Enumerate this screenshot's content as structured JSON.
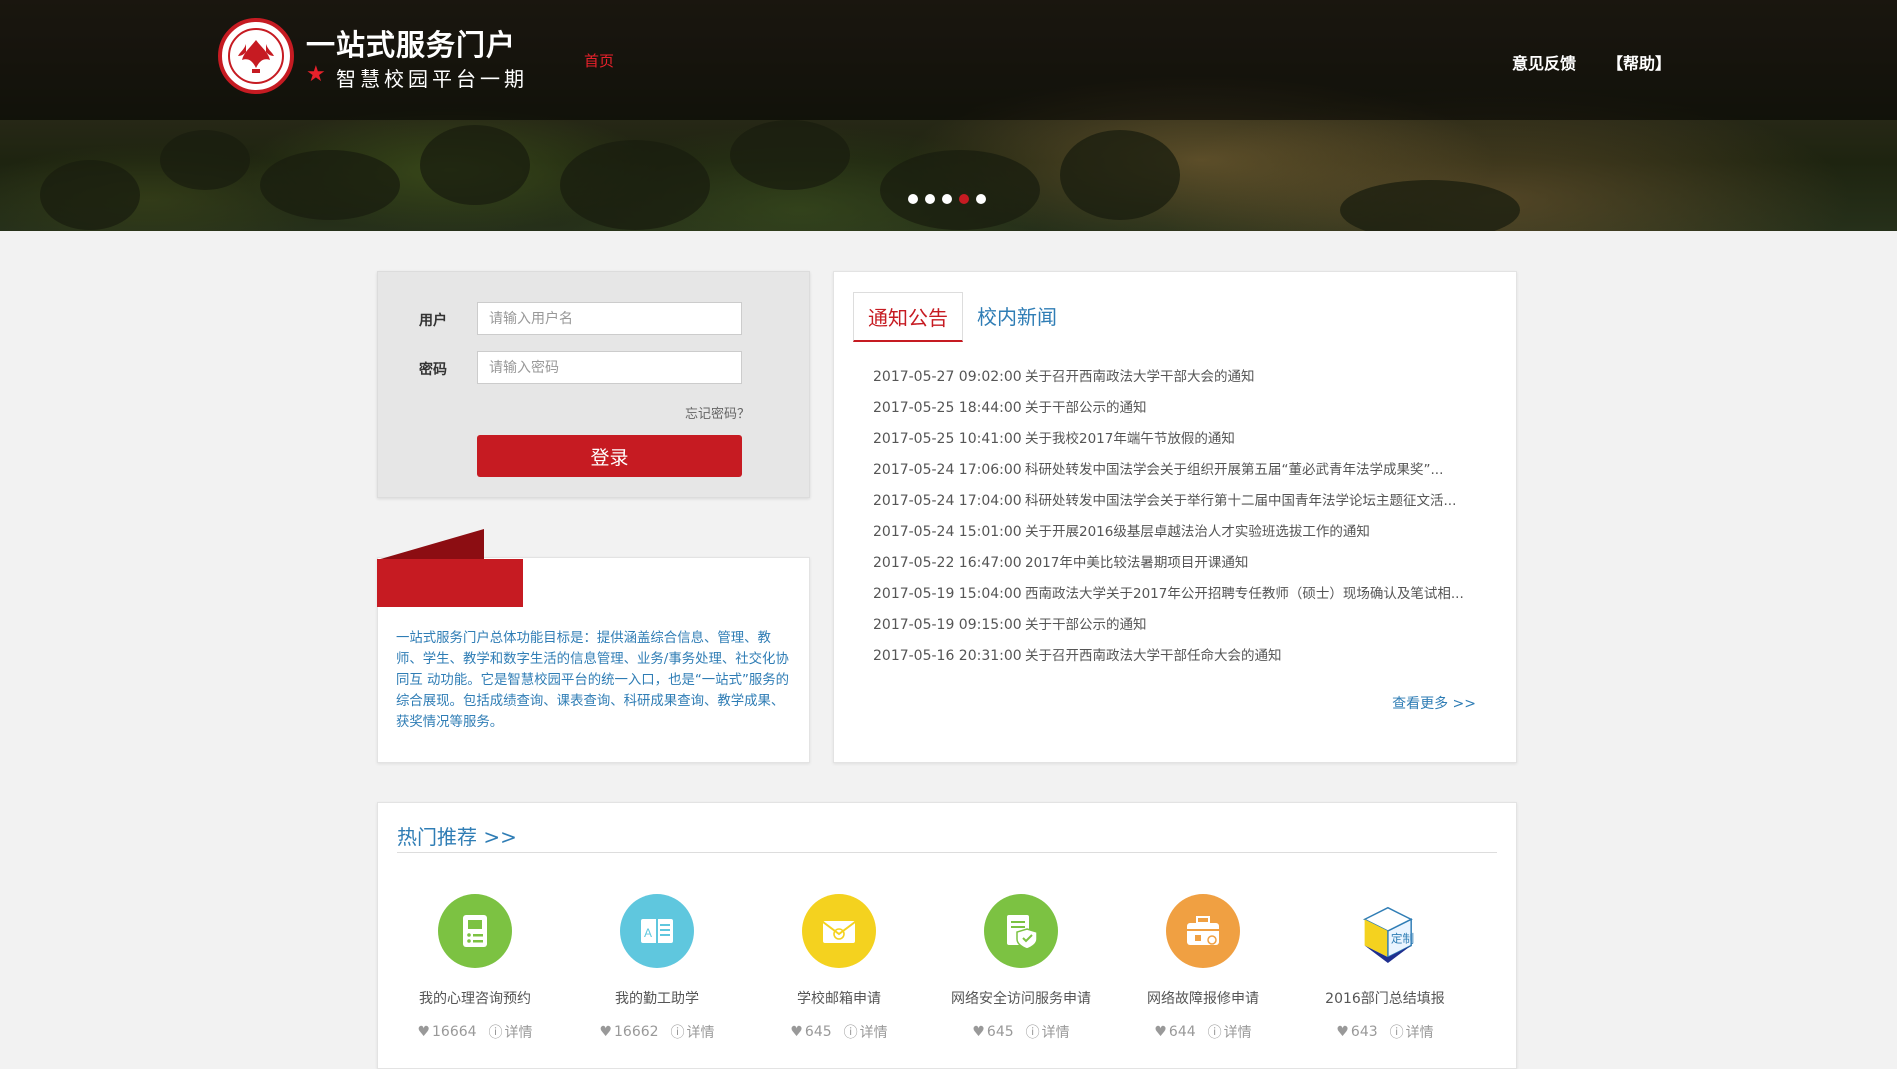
{
  "header": {
    "site_title": "一站式服务门户",
    "site_subtitle": "智慧校园平台一期",
    "nav_home": "首页",
    "nav_feedback": "意见反馈",
    "nav_help": "【帮助】",
    "carousel_dots": 5,
    "carousel_active_index": 3
  },
  "login": {
    "user_label": "用户",
    "user_placeholder": "请输入用户名",
    "password_label": "密码",
    "password_placeholder": "请输入密码",
    "forgot": "忘记密码？",
    "submit": "登录"
  },
  "intro": {
    "text": "一站式服务门户总体功能目标是：提供涵盖综合信息、管理、教师、学生、教学和数字生活的信息管理、业务/事务处理、社交化协同互 动功能。它是智慧校园平台的统一入口，也是“一站式”服务的综合展现。包括成绩查询、课表查询、科研成果查询、教学成果、获奖情况等服务。"
  },
  "news": {
    "tab_notice": "通知公告",
    "tab_campus": "校内新闻",
    "more": "查看更多 >>",
    "items": [
      {
        "date": "2017-05-27 09:02:00",
        "title": "关于召开西南政法大学干部大会的通知"
      },
      {
        "date": "2017-05-25 18:44:00",
        "title": "关于干部公示的通知"
      },
      {
        "date": "2017-05-25 10:41:00",
        "title": "关于我校2017年端午节放假的通知"
      },
      {
        "date": "2017-05-24 17:06:00",
        "title": "科研处转发中国法学会关于组织开展第五届“董必武青年法学成果奖”..."
      },
      {
        "date": "2017-05-24 17:04:00",
        "title": "科研处转发中国法学会关于举行第十二届中国青年法学论坛主题征文活..."
      },
      {
        "date": "2017-05-24 15:01:00",
        "title": "关于开展2016级基层卓越法治人才实验班选拔工作的通知"
      },
      {
        "date": "2017-05-22 16:47:00",
        "title": "2017年中美比较法暑期项目开课通知"
      },
      {
        "date": "2017-05-19 15:04:00",
        "title": "西南政法大学关于2017年公开招聘专任教师（硕士）现场确认及笔试相..."
      },
      {
        "date": "2017-05-19 09:15:00",
        "title": "关于干部公示的通知"
      },
      {
        "date": "2017-05-16 20:31:00",
        "title": "关于召开西南政法大学干部任命大会的通知"
      }
    ]
  },
  "hot": {
    "title": "热门推荐 >>",
    "detail_label": "详情",
    "services": [
      {
        "name": "我的心理咨询预约",
        "likes": "16664",
        "icon": "clipboard-list-icon",
        "color": "#7cc242"
      },
      {
        "name": "我的勤工助学",
        "likes": "16662",
        "icon": "book-open-icon",
        "color": "#5fc7de"
      },
      {
        "name": "学校邮箱申请",
        "likes": "645",
        "icon": "envelope-icon",
        "color": "#f4d21f"
      },
      {
        "name": "网络安全访问服务申请",
        "likes": "645",
        "icon": "secure-document-icon",
        "color": "#7cc242"
      },
      {
        "name": "网络故障报修申请",
        "likes": "644",
        "icon": "toolbox-icon",
        "color": "#f0a042"
      },
      {
        "name": "2016部门总结填报",
        "likes": "643",
        "icon": "custom-cube-icon",
        "color": "#f4d21f"
      }
    ]
  },
  "colors": {
    "brand_red": "#c61b22",
    "link_blue": "#2f7db5"
  }
}
